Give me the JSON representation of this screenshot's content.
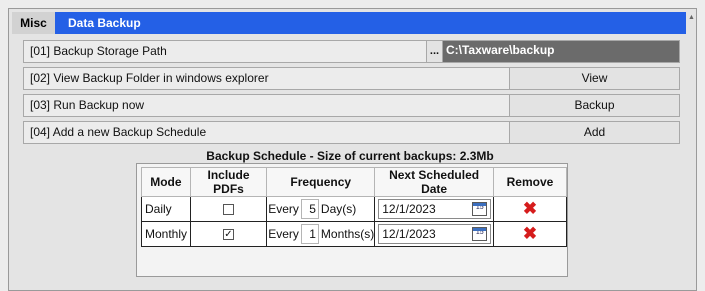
{
  "header": {
    "tab": "Misc",
    "title": "Data Backup"
  },
  "rows": {
    "storage": {
      "label": "[01] Backup Storage Path",
      "browse": "...",
      "path": "C:\\Taxware\\backup"
    },
    "view": {
      "label": "[02] View Backup Folder in windows explorer",
      "button": "View"
    },
    "run": {
      "label": "[03] Run Backup now",
      "button": "Backup"
    },
    "add": {
      "label": "[04] Add a new Backup Schedule",
      "button": "Add"
    }
  },
  "schedule": {
    "title": "Backup Schedule - Size of current backups: 2.3Mb",
    "columns": [
      "Mode",
      "Include PDFs",
      "Frequency",
      "Next Scheduled Date",
      "Remove"
    ],
    "items": [
      {
        "mode": "Daily",
        "include_pdfs": false,
        "check": "",
        "every": "Every",
        "count": "5",
        "unit": "Day(s)",
        "date": "12/1/2023",
        "cal": "15",
        "remove": "✖"
      },
      {
        "mode": "Monthly",
        "include_pdfs": true,
        "check": "✓",
        "every": "Every",
        "count": "1",
        "unit": "Months(s)",
        "date": "12/1/2023",
        "cal": "15",
        "remove": "✖"
      }
    ]
  },
  "colors": {
    "accent": "#2460e6",
    "path_bg": "#6b6b6b",
    "remove": "#d61c1c"
  },
  "icons": {
    "remove": "close-icon",
    "calendar": "calendar-icon",
    "check": "checkmark-icon",
    "scroll": "scroll-up-icon"
  }
}
